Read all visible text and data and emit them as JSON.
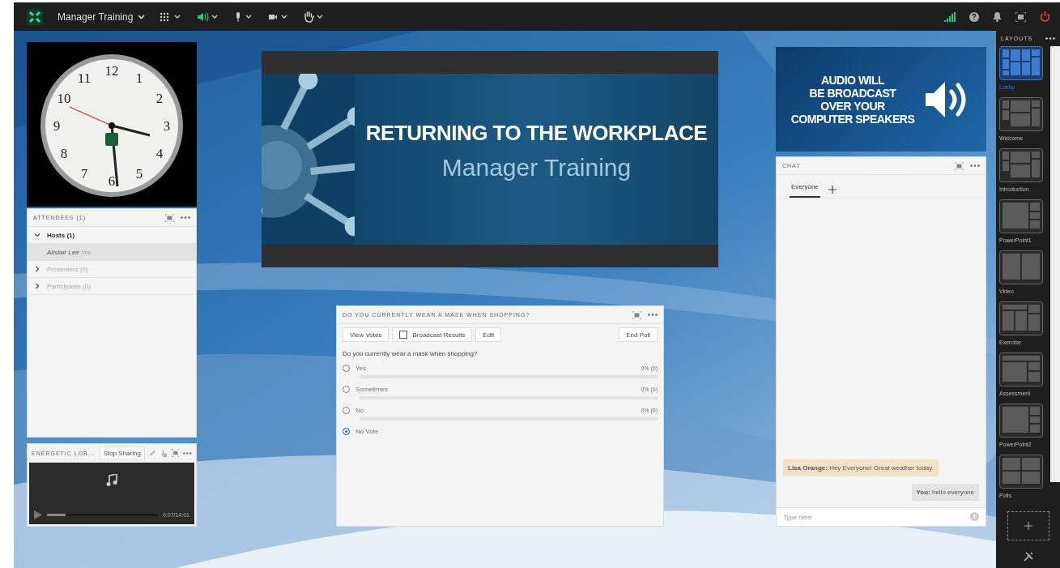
{
  "toolbar": {
    "meeting_title": "Manager Training",
    "audio_on": true
  },
  "clock": {
    "numerals": [
      "12",
      "1",
      "2",
      "3",
      "4",
      "5",
      "6",
      "7",
      "8",
      "9",
      "10",
      "11"
    ]
  },
  "attendees": {
    "title": "ATTENDEES (1)",
    "groups": [
      {
        "label": "Hosts (1)",
        "expanded": true,
        "members": [
          {
            "name": "Alistair Lee",
            "tag": "You",
            "selected": true
          }
        ]
      },
      {
        "label": "Presenters (0)",
        "expanded": false
      },
      {
        "label": "Participants (0)",
        "expanded": false
      }
    ]
  },
  "share_pod": {
    "title": "ENERGETIC LOB...",
    "button": "Stop Sharing",
    "player": {
      "level": 0.17,
      "time": "0:07/14:01"
    }
  },
  "slide": {
    "title": "RETURNING TO THE WORKPLACE",
    "subtitle": "Manager Training"
  },
  "poll": {
    "title": "DO YOU CURRENTLY WEAR A MASK WHEN SHOPPING?",
    "view_button": "View Votes",
    "broadcast": {
      "label": "Broadcast Results",
      "checked": false
    },
    "edit_button": "Edit",
    "end_button": "End Poll",
    "question": "Do you currently wear a mask when shopping?",
    "options": [
      {
        "label": "Yes",
        "result": "0% (0)",
        "level": 0,
        "selected": false
      },
      {
        "label": "Sometimes",
        "result": "0% (0)",
        "level": 0,
        "selected": false
      },
      {
        "label": "No",
        "result": "0% (0)",
        "level": 0,
        "selected": false
      },
      {
        "label": "No Vote",
        "selected": true
      }
    ]
  },
  "audio_banner": {
    "lines": [
      "AUDIO WILL",
      "BE BROADCAST",
      "OVER YOUR",
      "COMPUTER SPEAKERS"
    ]
  },
  "chat": {
    "title": "CHAT",
    "tabs": [
      {
        "label": "Everyone",
        "selected": true
      }
    ],
    "messages": [
      {
        "kind": "incoming",
        "text": "**Lisa Orange:** Hey Everyone! Great weather today."
      },
      {
        "kind": "outgoing",
        "text": "**You:** hello everyone"
      }
    ],
    "placeholder": "Type here"
  },
  "layouts": {
    "title": "LAYOUTS",
    "items": [
      {
        "label": "Lobby",
        "kind": "mosaic",
        "selected": true
      },
      {
        "label": "Welcome",
        "kind": "columns",
        "selected": false
      },
      {
        "label": "Introduction",
        "kind": "columns",
        "selected": false
      },
      {
        "label": "PowerPoint1",
        "kind": "main-side",
        "selected": false
      },
      {
        "label": "Video",
        "kind": "halves",
        "selected": false
      },
      {
        "label": "Exercise",
        "kind": "banner-columns",
        "selected": false
      },
      {
        "label": "Assessment",
        "kind": "banner-side",
        "selected": false
      },
      {
        "label": "PowerPoint2",
        "kind": "main-side",
        "selected": false
      },
      {
        "label": "Polls",
        "kind": "quad",
        "selected": false
      }
    ]
  }
}
